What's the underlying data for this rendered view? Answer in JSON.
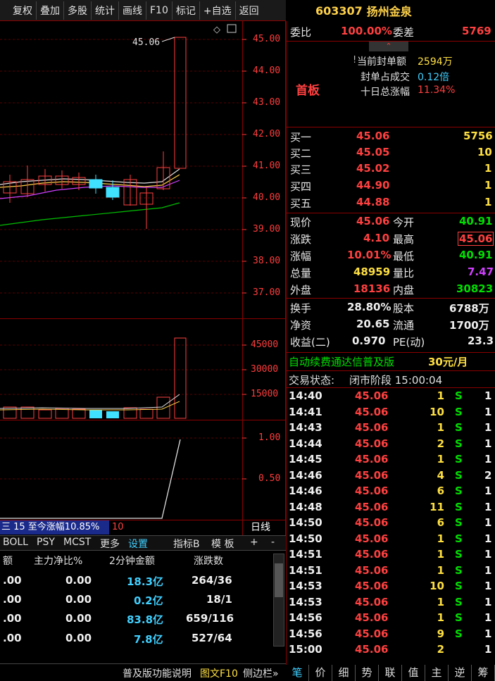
{
  "toolbar": {
    "items": [
      "复权",
      "叠加",
      "多股",
      "统计",
      "画线",
      "F10",
      "标记",
      "+自选",
      "返回"
    ]
  },
  "stock": {
    "code": "603307",
    "name": "扬州金泉"
  },
  "commission": {
    "ratio_label": "委比",
    "ratio_value": "100.00%",
    "diff_label": "委差",
    "diff_value": "5769"
  },
  "limit_up": {
    "badge": "首板",
    "seal_amount_label": "当前封单额",
    "seal_amount": "2594万",
    "seal_ratio_label": "封单占成交",
    "seal_ratio": "0.12倍",
    "ten_day_label": "十日总涨幅",
    "ten_day": "11.34%"
  },
  "bids": [
    {
      "label": "买一",
      "price": "45.06",
      "vol": "5756"
    },
    {
      "label": "买二",
      "price": "45.05",
      "vol": "10"
    },
    {
      "label": "买三",
      "price": "45.02",
      "vol": "1"
    },
    {
      "label": "买四",
      "price": "44.90",
      "vol": "1"
    },
    {
      "label": "买五",
      "price": "44.88",
      "vol": "1"
    }
  ],
  "quote": {
    "now_label": "现价",
    "now": "45.06",
    "open_label": "今开",
    "open": "40.91",
    "chg_label": "涨跌",
    "chg": "4.10",
    "high_label": "最高",
    "high": "45.06",
    "pct_label": "涨幅",
    "pct": "10.01%",
    "low_label": "最低",
    "low": "40.91",
    "vol_label": "总量",
    "vol": "48959",
    "vr_label": "量比",
    "vr": "7.47",
    "outer_label": "外盘",
    "outer": "18136",
    "inner_label": "内盘",
    "inner": "30823",
    "turn_label": "换手",
    "turn": "28.80%",
    "cap_label": "股本",
    "cap": "6788万",
    "nav_label": "净资",
    "nav": "20.65",
    "float_label": "流通",
    "float": "1700万",
    "eps_label": "收益(二)",
    "eps": "0.970",
    "pe_label": "PE(动)",
    "pe": "23.3"
  },
  "promo": {
    "text": "自动续费通达信普及版",
    "price": "30元/月"
  },
  "trade_status": {
    "label": "交易状态:",
    "value": "闭市阶段 15:00:04"
  },
  "ticks": [
    {
      "t": "14:40",
      "p": "45.06",
      "v": "1",
      "s": "S",
      "n": "1"
    },
    {
      "t": "14:41",
      "p": "45.06",
      "v": "10",
      "s": "S",
      "n": "1"
    },
    {
      "t": "14:43",
      "p": "45.06",
      "v": "1",
      "s": "S",
      "n": "1"
    },
    {
      "t": "14:44",
      "p": "45.06",
      "v": "2",
      "s": "S",
      "n": "1"
    },
    {
      "t": "14:45",
      "p": "45.06",
      "v": "1",
      "s": "S",
      "n": "1"
    },
    {
      "t": "14:46",
      "p": "45.06",
      "v": "4",
      "s": "S",
      "n": "2"
    },
    {
      "t": "14:46",
      "p": "45.06",
      "v": "6",
      "s": "S",
      "n": "1"
    },
    {
      "t": "14:48",
      "p": "45.06",
      "v": "11",
      "s": "S",
      "n": "1"
    },
    {
      "t": "14:50",
      "p": "45.06",
      "v": "6",
      "s": "S",
      "n": "1"
    },
    {
      "t": "14:50",
      "p": "45.06",
      "v": "1",
      "s": "S",
      "n": "1"
    },
    {
      "t": "14:51",
      "p": "45.06",
      "v": "1",
      "s": "S",
      "n": "1"
    },
    {
      "t": "14:51",
      "p": "45.06",
      "v": "1",
      "s": "S",
      "n": "1"
    },
    {
      "t": "14:53",
      "p": "45.06",
      "v": "10",
      "s": "S",
      "n": "1"
    },
    {
      "t": "14:53",
      "p": "45.06",
      "v": "1",
      "s": "S",
      "n": "1"
    },
    {
      "t": "14:56",
      "p": "45.06",
      "v": "1",
      "s": "S",
      "n": "1"
    },
    {
      "t": "14:56",
      "p": "45.06",
      "v": "9",
      "s": "S",
      "n": "1"
    },
    {
      "t": "15:00",
      "p": "45.06",
      "v": "2",
      "s": "",
      "n": "1"
    }
  ],
  "price_axis": [
    "45.00",
    "44.00",
    "43.00",
    "42.00",
    "41.00",
    "40.00",
    "39.00",
    "38.00",
    "37.00"
  ],
  "price_label": "45.06",
  "vol_axis": [
    "45000",
    "30000",
    "15000"
  ],
  "ind_axis": [
    "1.00",
    "0.50"
  ],
  "chart_strip": {
    "text": "三 15 至今涨幅10.85%",
    "value": "10",
    "period": "日线"
  },
  "indicator_tabs": [
    "BOLL",
    "PSY",
    "MCST",
    "更多",
    "设置",
    "指标B",
    "模 板",
    "+",
    "-"
  ],
  "bottom_table": {
    "headers": [
      "额",
      "主力净比%",
      "2分钟金额",
      "涨跌数"
    ],
    "rows": [
      [
        ".00",
        "0.00",
        "18.3亿",
        "264/36"
      ],
      [
        ".00",
        "0.00",
        "0.2亿",
        "18/1"
      ],
      [
        ".00",
        "0.00",
        "83.8亿",
        "659/116"
      ],
      [
        ".00",
        "0.00",
        "7.8亿",
        "527/64"
      ]
    ]
  },
  "status_bar": {
    "help": "普及版功能说明",
    "f10": "图文F10",
    "side": "侧边栏»"
  },
  "right_tabs": [
    "笔",
    "价",
    "细",
    "势",
    "联",
    "值",
    "主",
    "逆",
    "筹"
  ],
  "colors": {
    "up": "#ff4040",
    "down": "#00e000",
    "grid": "#8b0000",
    "accent": "#ffd24a"
  }
}
